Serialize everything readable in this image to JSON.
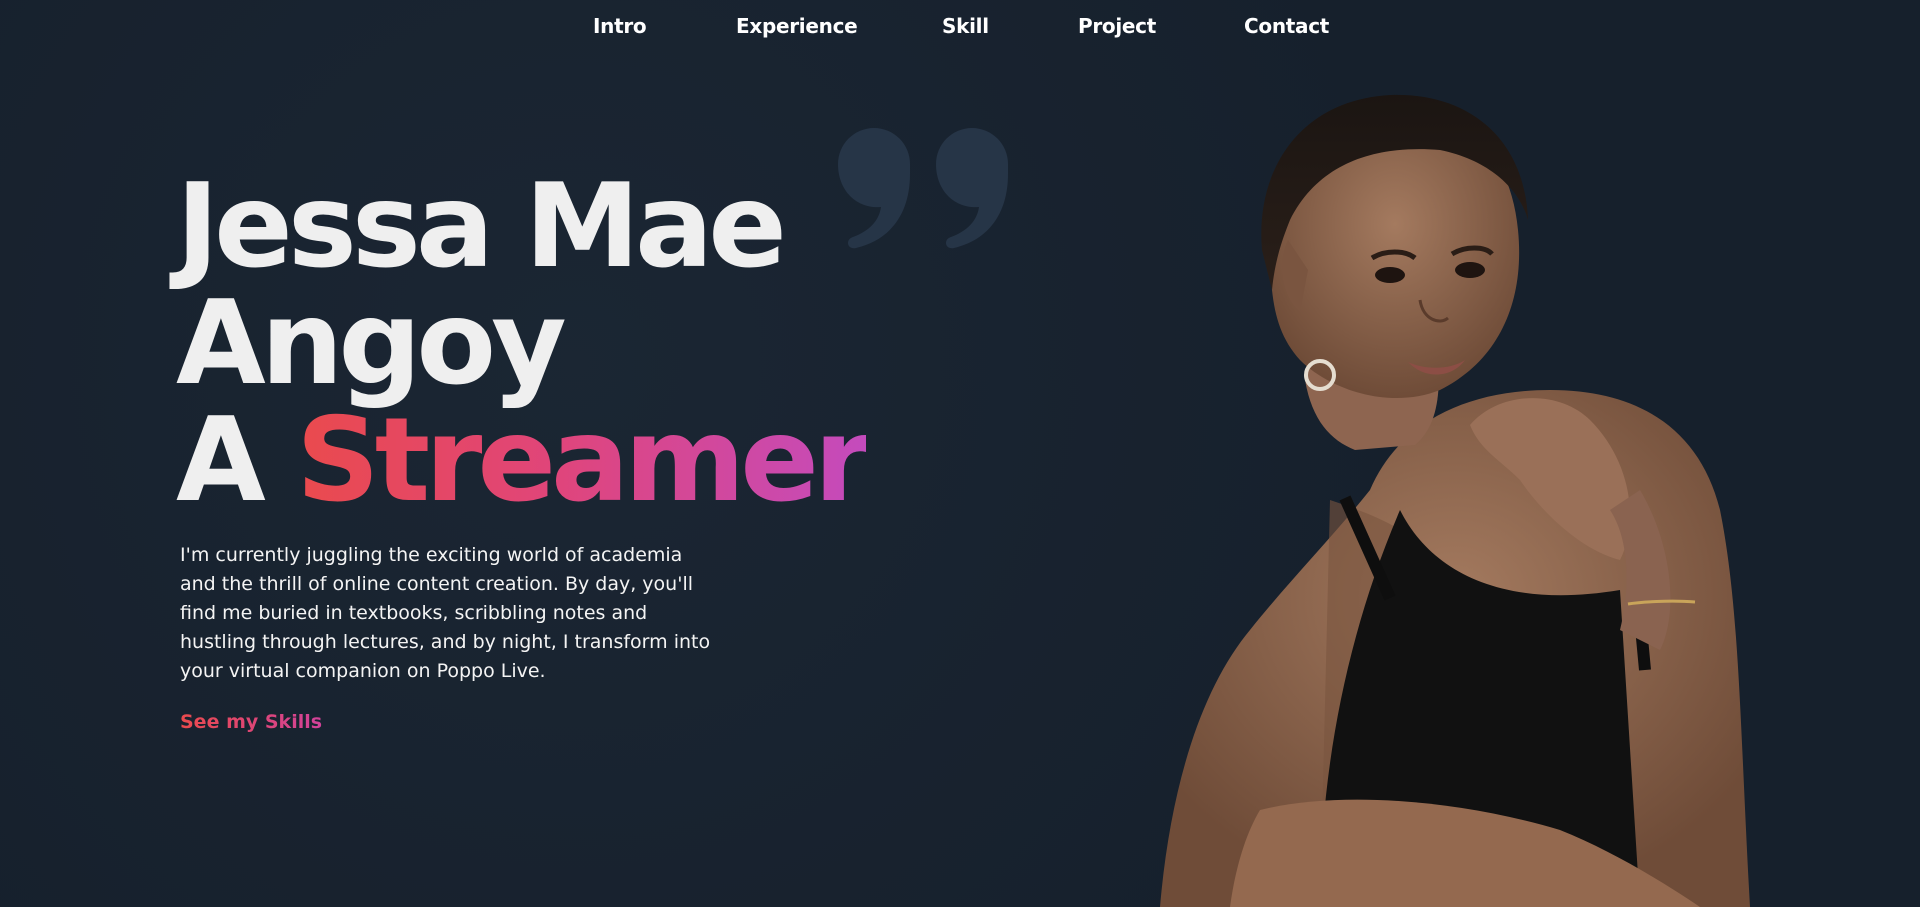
{
  "nav": {
    "items": [
      {
        "label": "Intro"
      },
      {
        "label": "Experience"
      },
      {
        "label": "Skill"
      },
      {
        "label": "Project"
      },
      {
        "label": "Contact"
      }
    ]
  },
  "hero": {
    "title_line1": "Jessa Mae",
    "title_line2": "Angoy",
    "title_line3_prefix": "A ",
    "title_line3_highlight": "Streamer",
    "bio": "I'm currently juggling the exciting world of academia and the thrill of online content creation. By day, you'll find me buried in textbooks, scribbling notes and hustling through lectures, and by night, I transform into your virtual companion on Poppo Live.",
    "cta_label": "See my Skills"
  },
  "colors": {
    "background": "#16202c",
    "quote_mark": "#263547",
    "gradient_start": "#ea4a4d",
    "gradient_mid": "#e0457a",
    "gradient_end": "#c44bbd",
    "text": "#efefef"
  },
  "icons": {
    "quote": "quote-icon"
  }
}
